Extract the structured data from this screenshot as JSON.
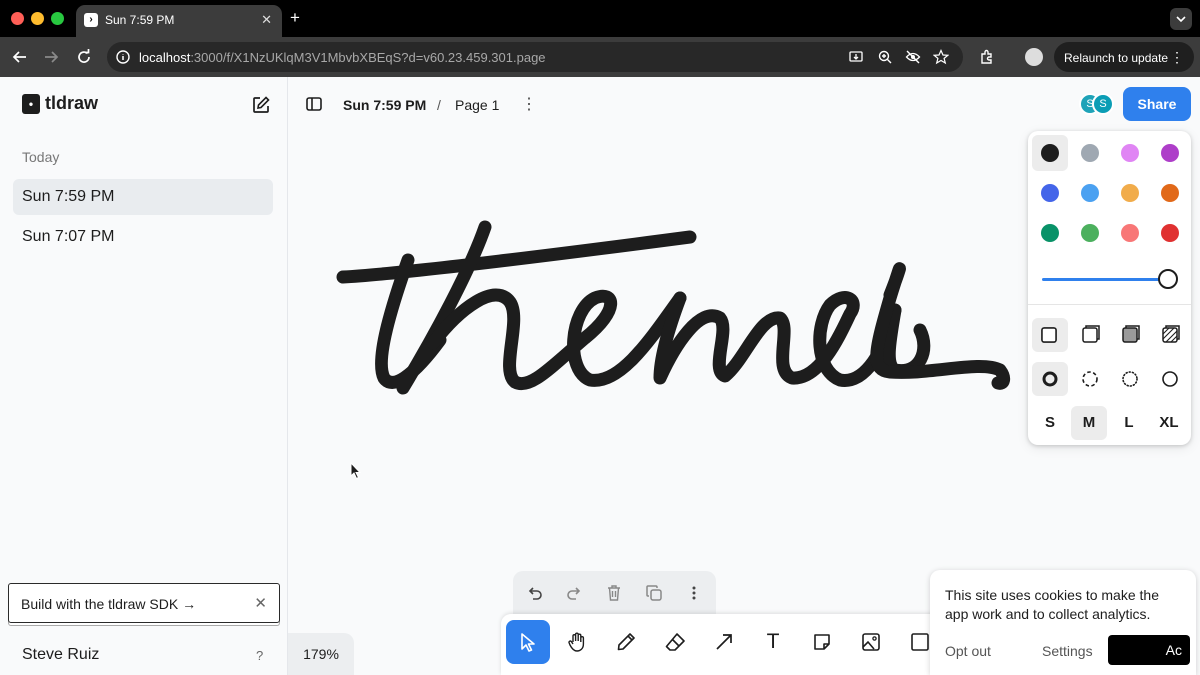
{
  "browser": {
    "tab_title": "Sun 7:59 PM",
    "tab_favicon": "›",
    "new_tab": "+",
    "url_host": "localhost",
    "url_rest": ":3000/f/X1NzUKlqM3V1MbvbXBEqS?d=v60.23.459.301.page",
    "relaunch_label": "Relaunch to update",
    "tab_close": "✕",
    "colors": {
      "chrome_bg": "#000000",
      "toolbar_bg": "#3c3c3c",
      "omnibox_bg": "#282828"
    }
  },
  "sidebar": {
    "logo_mark": "•",
    "logo_text": "tldraw",
    "section_label": "Today",
    "files": [
      {
        "label": "Sun 7:59 PM",
        "active": true
      },
      {
        "label": "Sun 7:07 PM",
        "active": false
      }
    ],
    "sdk_banner": "Build with the tldraw SDK →",
    "sdk_close": "✕",
    "user_name": "Steve Ruiz",
    "help": "?"
  },
  "header": {
    "file_name": "Sun 7:59 PM",
    "separator": "/",
    "page_name": "Page 1",
    "menu": "⋮",
    "avatars": [
      {
        "initial": "S",
        "color": "#1fa3b8"
      },
      {
        "initial": "S",
        "color": "#0b9db5"
      }
    ],
    "share_label": "Share",
    "accent": "#2f80ed"
  },
  "canvas": {
    "drawing_text": "themes",
    "zoom": "179%"
  },
  "style_panel": {
    "colors": [
      "#1d1d1d",
      "#9fa8b2",
      "#e085f4",
      "#ae3ec9",
      "#4465e9",
      "#4ba1f1",
      "#f1ac4b",
      "#e16919",
      "#099268",
      "#4cb05e",
      "#f87777",
      "#e03131"
    ],
    "selected_color": "#1d1d1d",
    "opacity": 1.0,
    "fill_options": [
      "none",
      "semi",
      "solid",
      "pattern"
    ],
    "dash_options": [
      "draw",
      "dashed",
      "dotted",
      "solid"
    ],
    "sizes": [
      "S",
      "M",
      "L",
      "XL"
    ],
    "selected_size": "M"
  },
  "toolbar": {
    "actions": [
      "undo-icon",
      "redo-icon",
      "trash-icon",
      "duplicate-icon",
      "more-icon"
    ],
    "tools": [
      "select",
      "hand",
      "draw",
      "eraser",
      "arrow",
      "text",
      "note",
      "image",
      "rectangle"
    ],
    "selected_tool": "select",
    "text_tool_glyph": "T"
  },
  "cookie_banner": {
    "text": "This site uses cookies to make the app work and to collect analytics.",
    "opt_out": "Opt out",
    "settings": "Settings",
    "accept": "Ac"
  }
}
